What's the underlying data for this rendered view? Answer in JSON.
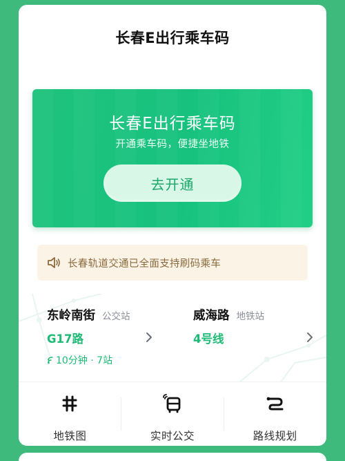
{
  "header": {
    "title": "长春E出行乘车码"
  },
  "hero": {
    "title": "长春E出行乘车码",
    "subtitle": "开通乘车码，便捷坐地铁",
    "button_label": "去开通"
  },
  "notice": {
    "text": "长春轨道交通已全面支持刷码乘车"
  },
  "nearby": [
    {
      "station": "东岭南街",
      "type": "公交站",
      "route": "G17路",
      "eta": "10分钟 · 7站"
    },
    {
      "station": "威海路",
      "type": "地铁站",
      "route": "4号线"
    }
  ],
  "nav": [
    {
      "label": "地铁图",
      "icon": "metro-map-icon"
    },
    {
      "label": "实时公交",
      "icon": "realtime-bus-icon"
    },
    {
      "label": "路线规划",
      "icon": "route-planning-icon"
    }
  ],
  "colors": {
    "background": "#3dba7c",
    "accent": "#1dbb75",
    "hero": "#17c27e",
    "notice_bg": "#faf3e6",
    "notice_text": "#8c6a3c"
  }
}
